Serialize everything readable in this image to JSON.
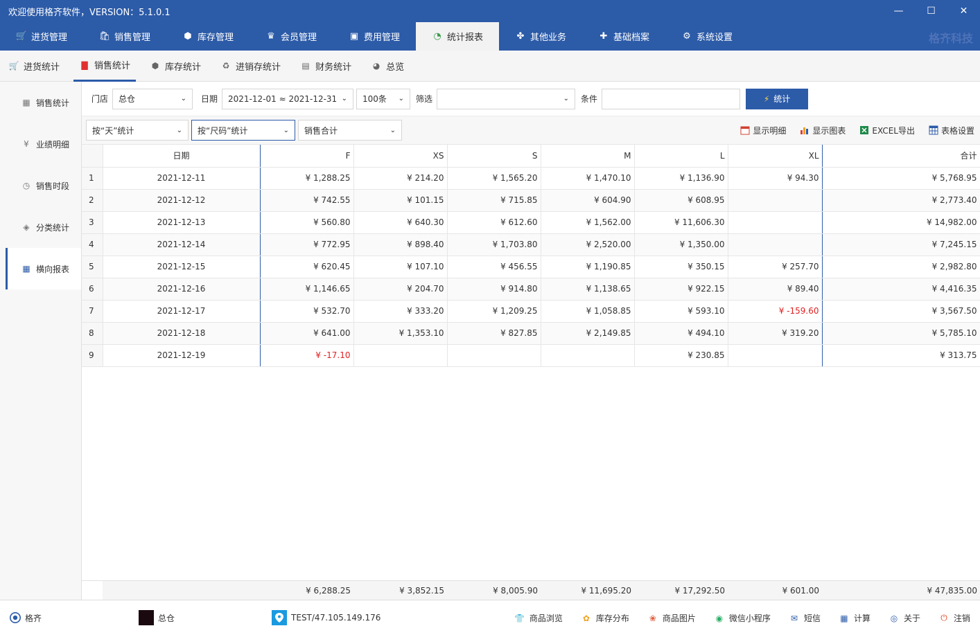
{
  "window": {
    "title": "欢迎使用格齐软件，VERSION：5.1.0.1",
    "min_glyph": "—",
    "max_glyph": "☐",
    "close_glyph": "✕"
  },
  "main_nav": {
    "items": [
      {
        "label": "进货管理",
        "icon": "cart-icon",
        "glyph": "🛒"
      },
      {
        "label": "销售管理",
        "icon": "shop-icon",
        "glyph": "🛍"
      },
      {
        "label": "库存管理",
        "icon": "box-icon",
        "glyph": "⬢"
      },
      {
        "label": "会员管理",
        "icon": "crown-icon",
        "glyph": "♛"
      },
      {
        "label": "费用管理",
        "icon": "wallet-icon",
        "glyph": "▣"
      },
      {
        "label": "统计报表",
        "icon": "pie-icon",
        "glyph": "◔"
      },
      {
        "label": "其他业务",
        "icon": "apps-icon",
        "glyph": "✤"
      },
      {
        "label": "基础档案",
        "icon": "puzzle-icon",
        "glyph": "✚"
      },
      {
        "label": "系统设置",
        "icon": "gear-icon",
        "glyph": "⚙"
      }
    ],
    "active_index": 5,
    "brand": "格齐科技"
  },
  "sub_nav": {
    "items": [
      {
        "label": "进货统计",
        "icon": "cart-icon",
        "glyph": "🛒"
      },
      {
        "label": "销售统计",
        "icon": "bag-icon",
        "glyph": "▇"
      },
      {
        "label": "库存统计",
        "icon": "box-icon",
        "glyph": "⬢"
      },
      {
        "label": "进销存统计",
        "icon": "recycle-icon",
        "glyph": "♻"
      },
      {
        "label": "财务统计",
        "icon": "safe-icon",
        "glyph": "▤"
      },
      {
        "label": "总览",
        "icon": "pie-icon",
        "glyph": "◕"
      }
    ],
    "active_index": 1
  },
  "sidebar": {
    "items": [
      {
        "label": "销售统计",
        "icon": "chart-icon",
        "glyph": "▦"
      },
      {
        "label": "业绩明细",
        "icon": "money-icon",
        "glyph": "¥"
      },
      {
        "label": "销售时段",
        "icon": "clock-icon",
        "glyph": "◷"
      },
      {
        "label": "分类统计",
        "icon": "layers-icon",
        "glyph": "◈"
      },
      {
        "label": "横向报表",
        "icon": "grid-icon",
        "glyph": "▦"
      }
    ],
    "active_index": 4
  },
  "filters": {
    "store_label": "门店",
    "store_value": "总仓",
    "date_label": "日期",
    "date_value": "2021-12-01 ≈ 2021-12-31",
    "limit_value": "100条",
    "filter_label": "筛选",
    "filter_value": "",
    "condition_label": "条件",
    "condition_value": "",
    "stat_button": "统计",
    "stat_glyph": "⚡",
    "chev": "⌄",
    "group_by_day": "按“天”统计",
    "group_by_size": "按“尺码”统计",
    "metric": "销售合计"
  },
  "toolbar": {
    "show_detail": "显示明细",
    "show_chart": "显示图表",
    "excel_export": "EXCEL导出",
    "table_settings": "表格设置"
  },
  "table": {
    "headers": [
      "日期",
      "F",
      "XS",
      "S",
      "M",
      "L",
      "XL",
      "合计"
    ],
    "rows": [
      {
        "idx": "1",
        "date": "2021-12-11",
        "cells": [
          "¥ 1,288.25",
          "¥ 214.20",
          "¥ 1,565.20",
          "¥ 1,470.10",
          "¥ 1,136.90",
          "¥ 94.30",
          "¥ 5,768.95"
        ]
      },
      {
        "idx": "2",
        "date": "2021-12-12",
        "cells": [
          "¥ 742.55",
          "¥ 101.15",
          "¥ 715.85",
          "¥ 604.90",
          "¥ 608.95",
          "",
          "¥ 2,773.40"
        ]
      },
      {
        "idx": "3",
        "date": "2021-12-13",
        "cells": [
          "¥ 560.80",
          "¥ 640.30",
          "¥ 612.60",
          "¥ 1,562.00",
          "¥ 11,606.30",
          "",
          "¥ 14,982.00"
        ]
      },
      {
        "idx": "4",
        "date": "2021-12-14",
        "cells": [
          "¥ 772.95",
          "¥ 898.40",
          "¥ 1,703.80",
          "¥ 2,520.00",
          "¥ 1,350.00",
          "",
          "¥ 7,245.15"
        ]
      },
      {
        "idx": "5",
        "date": "2021-12-15",
        "cells": [
          "¥ 620.45",
          "¥ 107.10",
          "¥ 456.55",
          "¥ 1,190.85",
          "¥ 350.15",
          "¥ 257.70",
          "¥ 2,982.80"
        ]
      },
      {
        "idx": "6",
        "date": "2021-12-16",
        "cells": [
          "¥ 1,146.65",
          "¥ 204.70",
          "¥ 914.80",
          "¥ 1,138.65",
          "¥ 922.15",
          "¥ 89.40",
          "¥ 4,416.35"
        ]
      },
      {
        "idx": "7",
        "date": "2021-12-17",
        "cells": [
          "¥ 532.70",
          "¥ 333.20",
          "¥ 1,209.25",
          "¥ 1,058.85",
          "¥ 593.10",
          "¥ -159.60",
          "¥ 3,567.50"
        ]
      },
      {
        "idx": "8",
        "date": "2021-12-18",
        "cells": [
          "¥ 641.00",
          "¥ 1,353.10",
          "¥ 827.85",
          "¥ 2,149.85",
          "¥ 494.10",
          "¥ 319.20",
          "¥ 5,785.10"
        ]
      },
      {
        "idx": "9",
        "date": "2021-12-19",
        "cells": [
          "¥ -17.10",
          "",
          "",
          "",
          "¥ 230.85",
          "",
          "¥ 313.75"
        ]
      }
    ],
    "totals": [
      "¥ 6,288.25",
      "¥ 3,852.15",
      "¥ 8,005.90",
      "¥ 11,695.20",
      "¥ 17,292.50",
      "¥ 601.00",
      "¥ 47,835.00"
    ]
  },
  "statusbar": {
    "user": "格齐",
    "store": "总仓",
    "server": "TEST/47.105.149.176",
    "actions": [
      {
        "label": "商品浏览",
        "icon": "shirt-icon",
        "glyph": "👕",
        "color": "#e0605a"
      },
      {
        "label": "库存分布",
        "icon": "dots-icon",
        "glyph": "✿",
        "color": "#f0a020"
      },
      {
        "label": "商品图片",
        "icon": "flower-icon",
        "glyph": "❀",
        "color": "#e06040"
      },
      {
        "label": "微信小程序",
        "icon": "wechat-icon",
        "glyph": "◉",
        "color": "#2aae67"
      },
      {
        "label": "短信",
        "icon": "mail-icon",
        "glyph": "✉",
        "color": "#2c5ba8"
      },
      {
        "label": "计算",
        "icon": "calc-icon",
        "glyph": "▦",
        "color": "#2c5ba8"
      },
      {
        "label": "关于",
        "icon": "info-icon",
        "glyph": "◎",
        "color": "#2c5ba8"
      },
      {
        "label": "注销",
        "icon": "power-icon",
        "glyph": "⏻",
        "color": "#e04020"
      }
    ]
  },
  "colors": {
    "accent": "#2c5ba8",
    "negative": "#e02020"
  }
}
